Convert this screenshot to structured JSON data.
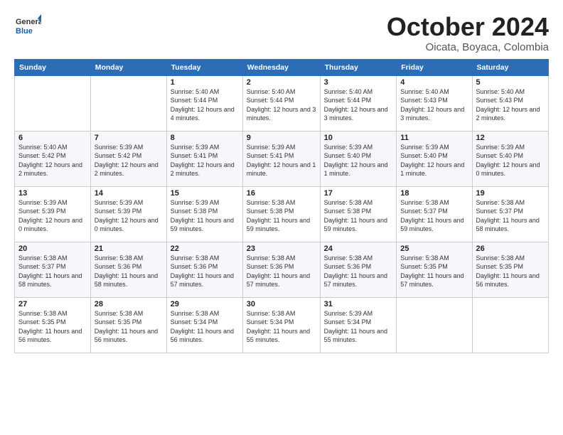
{
  "logo": {
    "general": "General",
    "blue": "Blue"
  },
  "header": {
    "month": "October 2024",
    "location": "Oicata, Boyaca, Colombia"
  },
  "weekdays": [
    "Sunday",
    "Monday",
    "Tuesday",
    "Wednesday",
    "Thursday",
    "Friday",
    "Saturday"
  ],
  "weeks": [
    [
      {
        "day": "",
        "info": ""
      },
      {
        "day": "",
        "info": ""
      },
      {
        "day": "1",
        "info": "Sunrise: 5:40 AM\nSunset: 5:44 PM\nDaylight: 12 hours and 4 minutes."
      },
      {
        "day": "2",
        "info": "Sunrise: 5:40 AM\nSunset: 5:44 PM\nDaylight: 12 hours and 3 minutes."
      },
      {
        "day": "3",
        "info": "Sunrise: 5:40 AM\nSunset: 5:44 PM\nDaylight: 12 hours and 3 minutes."
      },
      {
        "day": "4",
        "info": "Sunrise: 5:40 AM\nSunset: 5:43 PM\nDaylight: 12 hours and 3 minutes."
      },
      {
        "day": "5",
        "info": "Sunrise: 5:40 AM\nSunset: 5:43 PM\nDaylight: 12 hours and 2 minutes."
      }
    ],
    [
      {
        "day": "6",
        "info": "Sunrise: 5:40 AM\nSunset: 5:42 PM\nDaylight: 12 hours and 2 minutes."
      },
      {
        "day": "7",
        "info": "Sunrise: 5:39 AM\nSunset: 5:42 PM\nDaylight: 12 hours and 2 minutes."
      },
      {
        "day": "8",
        "info": "Sunrise: 5:39 AM\nSunset: 5:41 PM\nDaylight: 12 hours and 2 minutes."
      },
      {
        "day": "9",
        "info": "Sunrise: 5:39 AM\nSunset: 5:41 PM\nDaylight: 12 hours and 1 minute."
      },
      {
        "day": "10",
        "info": "Sunrise: 5:39 AM\nSunset: 5:40 PM\nDaylight: 12 hours and 1 minute."
      },
      {
        "day": "11",
        "info": "Sunrise: 5:39 AM\nSunset: 5:40 PM\nDaylight: 12 hours and 1 minute."
      },
      {
        "day": "12",
        "info": "Sunrise: 5:39 AM\nSunset: 5:40 PM\nDaylight: 12 hours and 0 minutes."
      }
    ],
    [
      {
        "day": "13",
        "info": "Sunrise: 5:39 AM\nSunset: 5:39 PM\nDaylight: 12 hours and 0 minutes."
      },
      {
        "day": "14",
        "info": "Sunrise: 5:39 AM\nSunset: 5:39 PM\nDaylight: 12 hours and 0 minutes."
      },
      {
        "day": "15",
        "info": "Sunrise: 5:39 AM\nSunset: 5:38 PM\nDaylight: 11 hours and 59 minutes."
      },
      {
        "day": "16",
        "info": "Sunrise: 5:38 AM\nSunset: 5:38 PM\nDaylight: 11 hours and 59 minutes."
      },
      {
        "day": "17",
        "info": "Sunrise: 5:38 AM\nSunset: 5:38 PM\nDaylight: 11 hours and 59 minutes."
      },
      {
        "day": "18",
        "info": "Sunrise: 5:38 AM\nSunset: 5:37 PM\nDaylight: 11 hours and 59 minutes."
      },
      {
        "day": "19",
        "info": "Sunrise: 5:38 AM\nSunset: 5:37 PM\nDaylight: 11 hours and 58 minutes."
      }
    ],
    [
      {
        "day": "20",
        "info": "Sunrise: 5:38 AM\nSunset: 5:37 PM\nDaylight: 11 hours and 58 minutes."
      },
      {
        "day": "21",
        "info": "Sunrise: 5:38 AM\nSunset: 5:36 PM\nDaylight: 11 hours and 58 minutes."
      },
      {
        "day": "22",
        "info": "Sunrise: 5:38 AM\nSunset: 5:36 PM\nDaylight: 11 hours and 57 minutes."
      },
      {
        "day": "23",
        "info": "Sunrise: 5:38 AM\nSunset: 5:36 PM\nDaylight: 11 hours and 57 minutes."
      },
      {
        "day": "24",
        "info": "Sunrise: 5:38 AM\nSunset: 5:36 PM\nDaylight: 11 hours and 57 minutes."
      },
      {
        "day": "25",
        "info": "Sunrise: 5:38 AM\nSunset: 5:35 PM\nDaylight: 11 hours and 57 minutes."
      },
      {
        "day": "26",
        "info": "Sunrise: 5:38 AM\nSunset: 5:35 PM\nDaylight: 11 hours and 56 minutes."
      }
    ],
    [
      {
        "day": "27",
        "info": "Sunrise: 5:38 AM\nSunset: 5:35 PM\nDaylight: 11 hours and 56 minutes."
      },
      {
        "day": "28",
        "info": "Sunrise: 5:38 AM\nSunset: 5:35 PM\nDaylight: 11 hours and 56 minutes."
      },
      {
        "day": "29",
        "info": "Sunrise: 5:38 AM\nSunset: 5:34 PM\nDaylight: 11 hours and 56 minutes."
      },
      {
        "day": "30",
        "info": "Sunrise: 5:38 AM\nSunset: 5:34 PM\nDaylight: 11 hours and 55 minutes."
      },
      {
        "day": "31",
        "info": "Sunrise: 5:39 AM\nSunset: 5:34 PM\nDaylight: 11 hours and 55 minutes."
      },
      {
        "day": "",
        "info": ""
      },
      {
        "day": "",
        "info": ""
      }
    ]
  ]
}
